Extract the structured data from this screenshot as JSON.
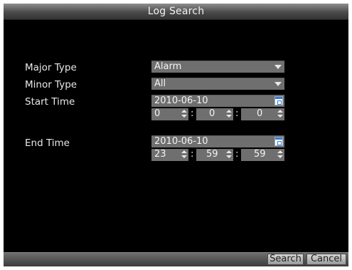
{
  "window": {
    "title": "Log Search"
  },
  "form": {
    "major_type": {
      "label": "Major Type",
      "value": "Alarm"
    },
    "minor_type": {
      "label": "Minor Type",
      "value": "All"
    },
    "start_time": {
      "label": "Start Time",
      "date": "2010-06-10",
      "hour": "0",
      "minute": "0",
      "second": "0"
    },
    "end_time": {
      "label": "End Time",
      "date": "2010-06-10",
      "hour": "23",
      "minute": "59",
      "second": "59"
    },
    "time_separator": ":"
  },
  "buttons": {
    "search": "Search",
    "cancel": "Cancel"
  },
  "icons": {
    "dropdown": "chevron-down-icon",
    "calendar": "calendar-icon",
    "spinner": "spinner-arrows-icon"
  },
  "colors": {
    "background": "#000000",
    "field": "#6f6f6f",
    "text": "#e9e9e9",
    "title_bar": "#4b4b4b"
  }
}
